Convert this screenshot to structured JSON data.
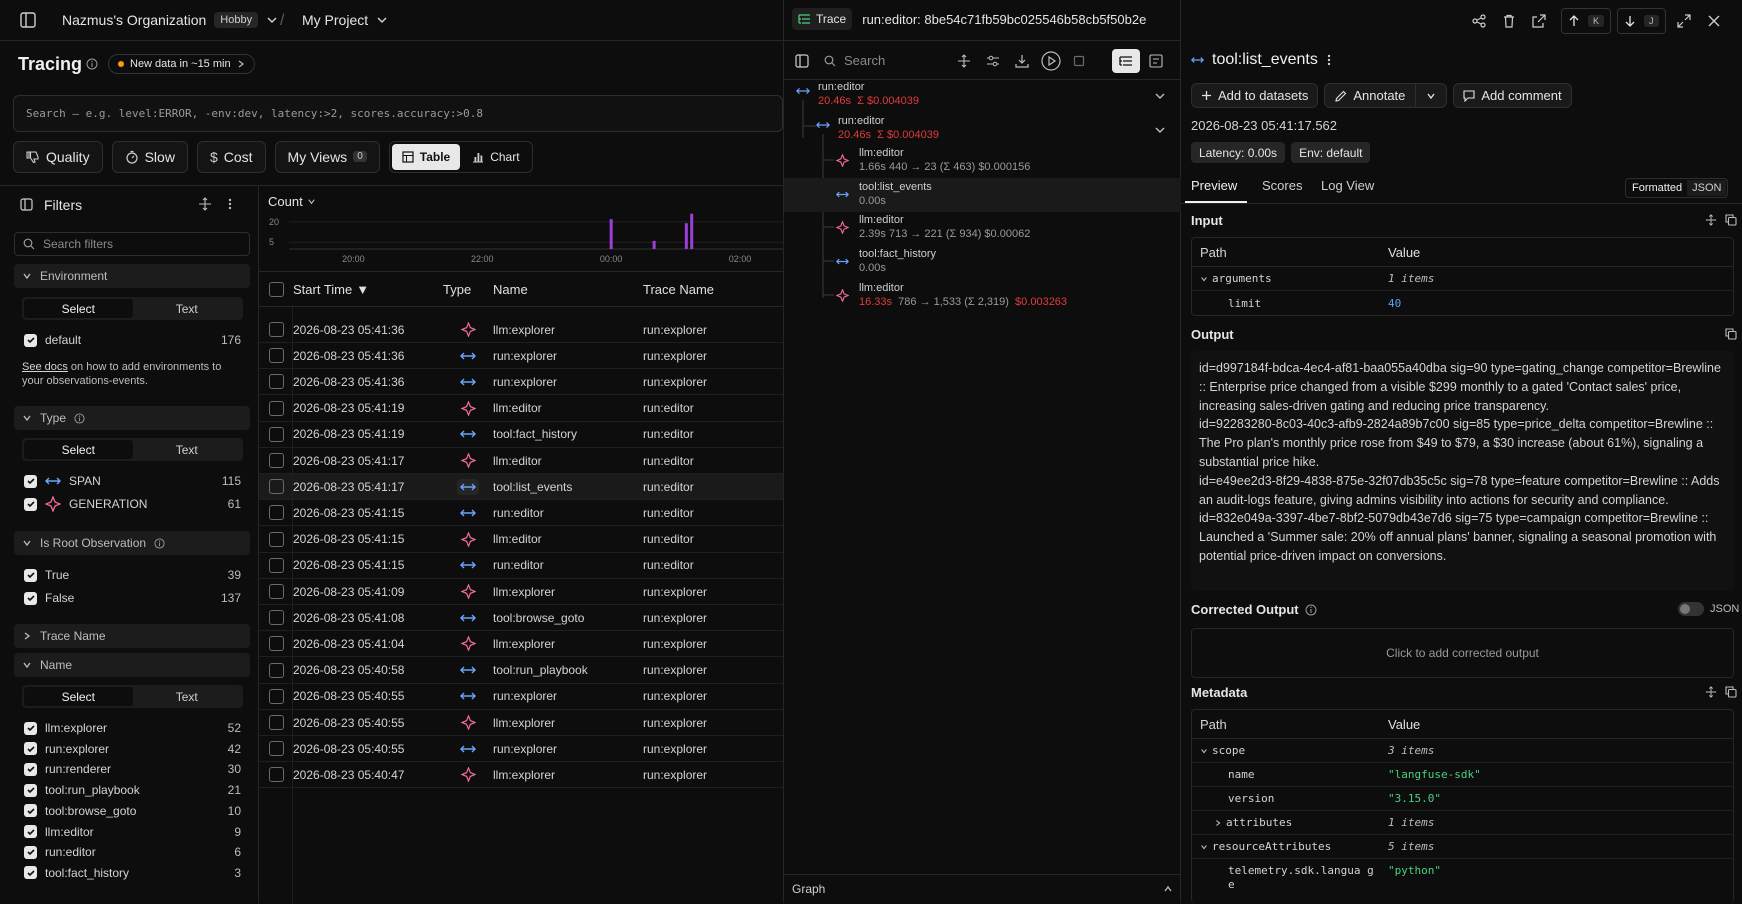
{
  "header": {
    "org": "Nazmus's Organization",
    "plan": "Hobby",
    "project": "My Project"
  },
  "tracing": {
    "title": "Tracing",
    "new_data": "New data in ~15 min",
    "search_placeholder": "Search — e.g. level:ERROR, -env:dev, latency:>2, scores.accuracy:>0.8",
    "chips": {
      "quality": "Quality",
      "slow": "Slow",
      "cost": "Cost",
      "my_views": "My Views",
      "my_views_count": "0",
      "table": "Table",
      "chart": "Chart"
    }
  },
  "filters": {
    "title": "Filters",
    "search_placeholder": "Search filters",
    "select_label": "Select",
    "text_label": "Text",
    "environment": {
      "label": "Environment",
      "items": [
        {
          "label": "default",
          "count": "176"
        }
      ],
      "docs_link": "See docs",
      "docs_text": " on how to add environments to your observations-events."
    },
    "type": {
      "label": "Type",
      "items": [
        {
          "label": "SPAN",
          "count": "115"
        },
        {
          "label": "GENERATION",
          "count": "61"
        }
      ]
    },
    "is_root": {
      "label": "Is Root Observation",
      "items": [
        {
          "label": "True",
          "count": "39"
        },
        {
          "label": "False",
          "count": "137"
        }
      ]
    },
    "trace_name": {
      "label": "Trace Name"
    },
    "name": {
      "label": "Name",
      "items": [
        {
          "label": "llm:explorer",
          "count": "52"
        },
        {
          "label": "run:explorer",
          "count": "42"
        },
        {
          "label": "run:renderer",
          "count": "30"
        },
        {
          "label": "tool:run_playbook",
          "count": "21"
        },
        {
          "label": "tool:browse_goto",
          "count": "10"
        },
        {
          "label": "llm:editor",
          "count": "9"
        },
        {
          "label": "run:editor",
          "count": "6"
        },
        {
          "label": "tool:fact_history",
          "count": "3"
        }
      ]
    }
  },
  "chart_data": {
    "type": "bar",
    "title": "Count",
    "x_ticks": [
      "20:00",
      "22:00",
      "00:00",
      "02:00"
    ],
    "y_ticks": [
      "20",
      "5"
    ],
    "bars": [
      {
        "x": "00:00",
        "value": 22
      },
      {
        "x": "00:40",
        "value": 6
      },
      {
        "x": "01:10",
        "value": 19
      },
      {
        "x": "01:15",
        "value": 26
      }
    ]
  },
  "table": {
    "columns": [
      "Start Time",
      "Type",
      "Name",
      "Trace Name"
    ],
    "rows": [
      {
        "time": "2026-08-23 05:41:36",
        "type": "generation",
        "name": "llm:explorer",
        "trace": "run:explorer"
      },
      {
        "time": "2026-08-23 05:41:36",
        "type": "span",
        "name": "run:explorer",
        "trace": "run:explorer"
      },
      {
        "time": "2026-08-23 05:41:36",
        "type": "span",
        "name": "run:explorer",
        "trace": "run:explorer"
      },
      {
        "time": "2026-08-23 05:41:19",
        "type": "generation",
        "name": "llm:editor",
        "trace": "run:editor"
      },
      {
        "time": "2026-08-23 05:41:19",
        "type": "span",
        "name": "tool:fact_history",
        "trace": "run:editor"
      },
      {
        "time": "2026-08-23 05:41:17",
        "type": "generation",
        "name": "llm:editor",
        "trace": "run:editor"
      },
      {
        "time": "2026-08-23 05:41:17",
        "type": "span",
        "name": "tool:list_events",
        "trace": "run:editor",
        "selected": true
      },
      {
        "time": "2026-08-23 05:41:15",
        "type": "span",
        "name": "run:editor",
        "trace": "run:editor"
      },
      {
        "time": "2026-08-23 05:41:15",
        "type": "generation",
        "name": "llm:editor",
        "trace": "run:editor"
      },
      {
        "time": "2026-08-23 05:41:15",
        "type": "span",
        "name": "run:editor",
        "trace": "run:editor"
      },
      {
        "time": "2026-08-23 05:41:09",
        "type": "generation",
        "name": "llm:explorer",
        "trace": "run:explorer"
      },
      {
        "time": "2026-08-23 05:41:08",
        "type": "span",
        "name": "tool:browse_goto",
        "trace": "run:explorer"
      },
      {
        "time": "2026-08-23 05:41:04",
        "type": "generation",
        "name": "llm:explorer",
        "trace": "run:explorer"
      },
      {
        "time": "2026-08-23 05:40:58",
        "type": "span",
        "name": "tool:run_playbook",
        "trace": "run:explorer"
      },
      {
        "time": "2026-08-23 05:40:55",
        "type": "span",
        "name": "run:explorer",
        "trace": "run:explorer"
      },
      {
        "time": "2026-08-23 05:40:55",
        "type": "generation",
        "name": "llm:explorer",
        "trace": "run:explorer"
      },
      {
        "time": "2026-08-23 05:40:55",
        "type": "span",
        "name": "run:explorer",
        "trace": "run:explorer"
      },
      {
        "time": "2026-08-23 05:40:47",
        "type": "generation",
        "name": "llm:explorer",
        "trace": "run:explorer"
      }
    ]
  },
  "trace": {
    "badge": "Trace",
    "id": "run:editor: 8be54c71fb59bc025546b58cb5f50b2e",
    "search_placeholder": "Search",
    "graph_label": "Graph",
    "nodes": [
      {
        "name": "run:editor",
        "latency": "20.46s",
        "cost": "Σ $0.004039"
      },
      {
        "name": "run:editor",
        "latency": "20.46s",
        "cost": "Σ $0.004039"
      },
      {
        "name": "llm:editor",
        "meta": "1.66s   440 → 23 (Σ 463)   $0.000156"
      },
      {
        "name": "tool:list_events",
        "meta": "0.00s"
      },
      {
        "name": "llm:editor",
        "meta": "2.39s   713 → 221 (Σ 934)   $0.00062"
      },
      {
        "name": "tool:fact_history",
        "meta": "0.00s"
      },
      {
        "name": "llm:editor",
        "latency": "16.33s",
        "meta": "786 → 1,533 (Σ 2,319)",
        "cost": "$0.003263"
      }
    ]
  },
  "detail": {
    "title": "tool:list_events",
    "add_to_datasets": "Add to datasets",
    "annotate": "Annotate",
    "add_comment": "Add comment",
    "timestamp": "2026-08-23 05:41:17.562",
    "latency": "Latency: 0.00s",
    "env": "Env: default",
    "tabs": [
      "Preview",
      "Scores",
      "Log View"
    ],
    "format_toggle": [
      "Formatted",
      "JSON"
    ],
    "input_label": "Input",
    "path_header": "Path",
    "value_header": "Value",
    "input_rows": [
      {
        "key": "arguments",
        "value": "1 items"
      },
      {
        "key": "limit",
        "value": "40"
      }
    ],
    "output_label": "Output",
    "output_text": "id=d997184f-bdca-4ec4-af81-baa055a40dba sig=90 type=gating_change competitor=Brewline :: Enterprise price changed from a visible $299 monthly to a gated 'Contact sales' price, increasing sales-driven gating and reducing price transparency.\nid=92283280-8c03-40c3-afb9-2824a89b7c00 sig=85 type=price_delta competitor=Brewline :: The Pro plan's monthly price rose from $49 to $79, a $30 increase (about 61%), signaling a substantial price hike.\nid=e49ee2d3-8f29-4838-875e-32f07db35c5c sig=78 type=feature competitor=Brewline :: Adds an audit-logs feature, giving admins visibility into actions for security and compliance.\nid=832e049a-3397-4be7-8bf2-5079db43e7d6 sig=75 type=campaign competitor=Brewline :: Launched a 'Summer sale: 20% off annual plans' banner, signaling a seasonal promotion with potential price-driven impact on conversions.",
    "corrected_label": "Corrected Output",
    "corrected_json": "JSON",
    "corrected_placeholder": "Click to add corrected output",
    "metadata_label": "Metadata",
    "metadata_rows": [
      {
        "key": "scope",
        "value": "3 items"
      },
      {
        "key": "name",
        "value": "\"langfuse-sdk\""
      },
      {
        "key": "version",
        "value": "\"3.15.0\""
      },
      {
        "key": "attributes",
        "value": "1 items"
      },
      {
        "key": "resourceAttributes",
        "value": "5 items"
      },
      {
        "key": "telemetry.sdk.langua ge",
        "value": "\"python\""
      }
    ]
  },
  "colors": {
    "accent_purple": "#9b3fd8",
    "span_blue": "#6aa4ff",
    "generation_pink": "#f26b9e",
    "cost_red": "#e33b3b"
  }
}
